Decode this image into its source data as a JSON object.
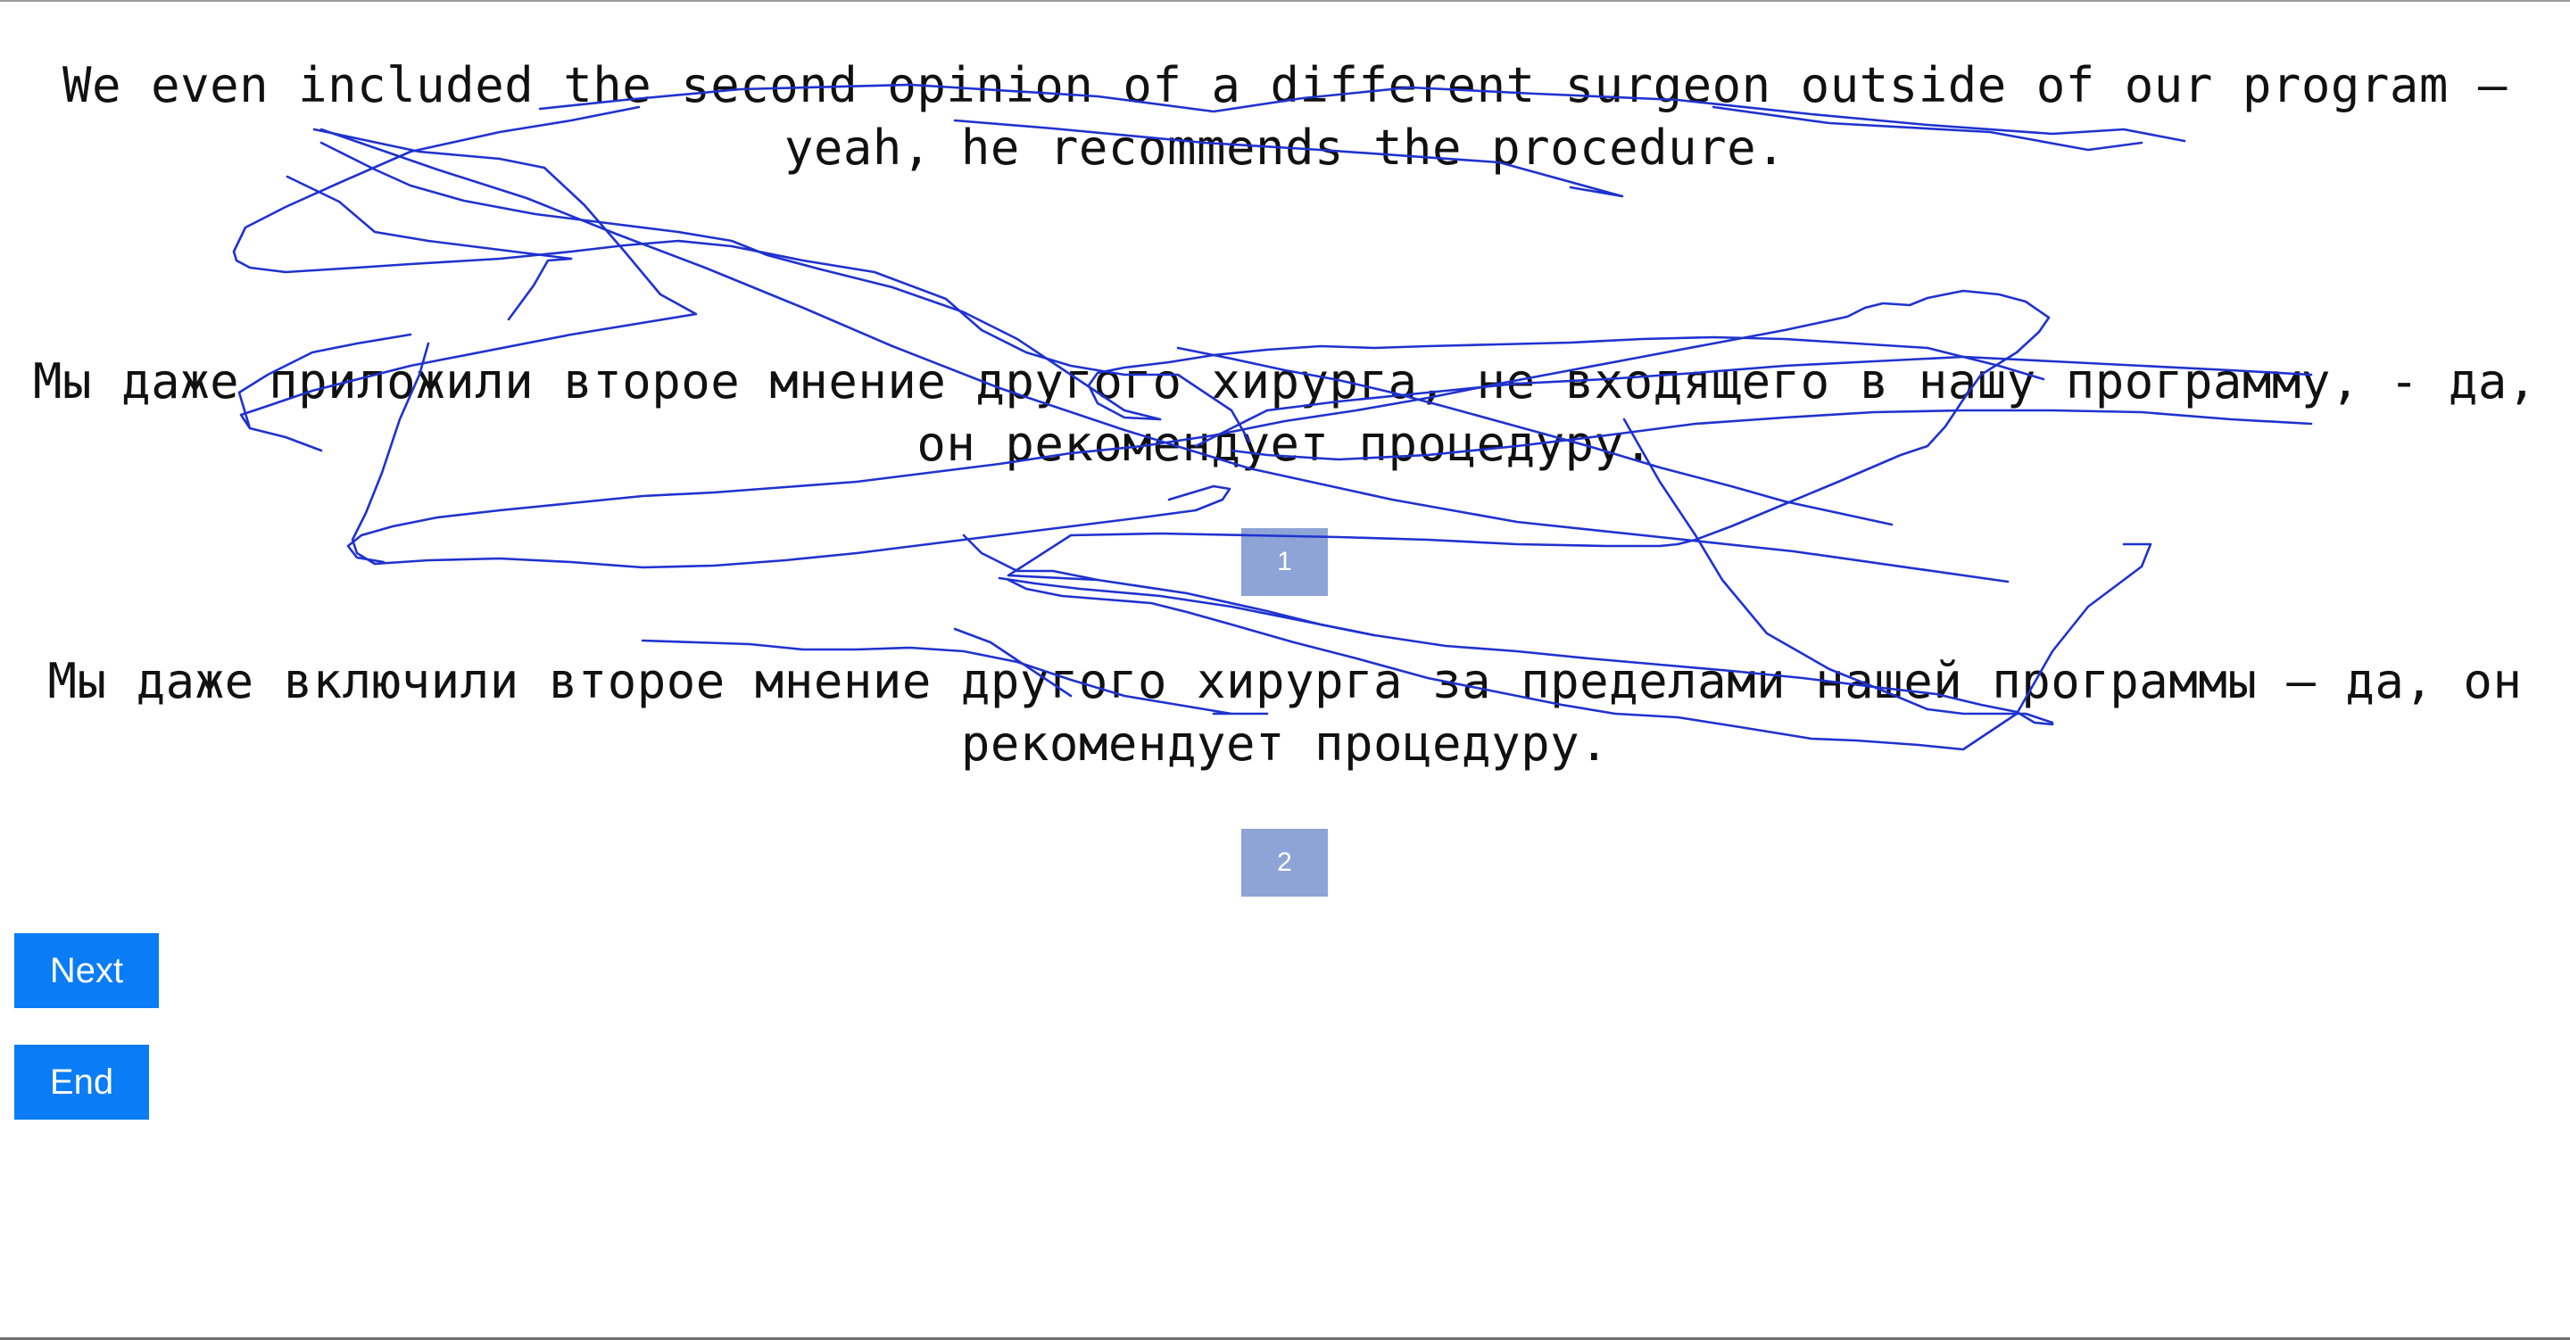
{
  "source": {
    "text": "We even included the second opinion of a different surgeon outside of our program — yeah, he recommends the procedure."
  },
  "translations": [
    {
      "text": "Мы даже приложили второе мнение другого хирурга, не входящего в нашу программу, - да, он рекомендует процедуру.",
      "choice_label": "1"
    },
    {
      "text": "Мы даже включили второе мнение другого хирурга за пределами нашей программы — да, он рекомендует процедуру.",
      "choice_label": "2"
    }
  ],
  "buttons": {
    "next_label": "Next",
    "end_label": "End"
  },
  "colors": {
    "choice_badge": "#8ea3d6",
    "action_button": "#0a7cf6",
    "scribble": "#1f32cf"
  }
}
